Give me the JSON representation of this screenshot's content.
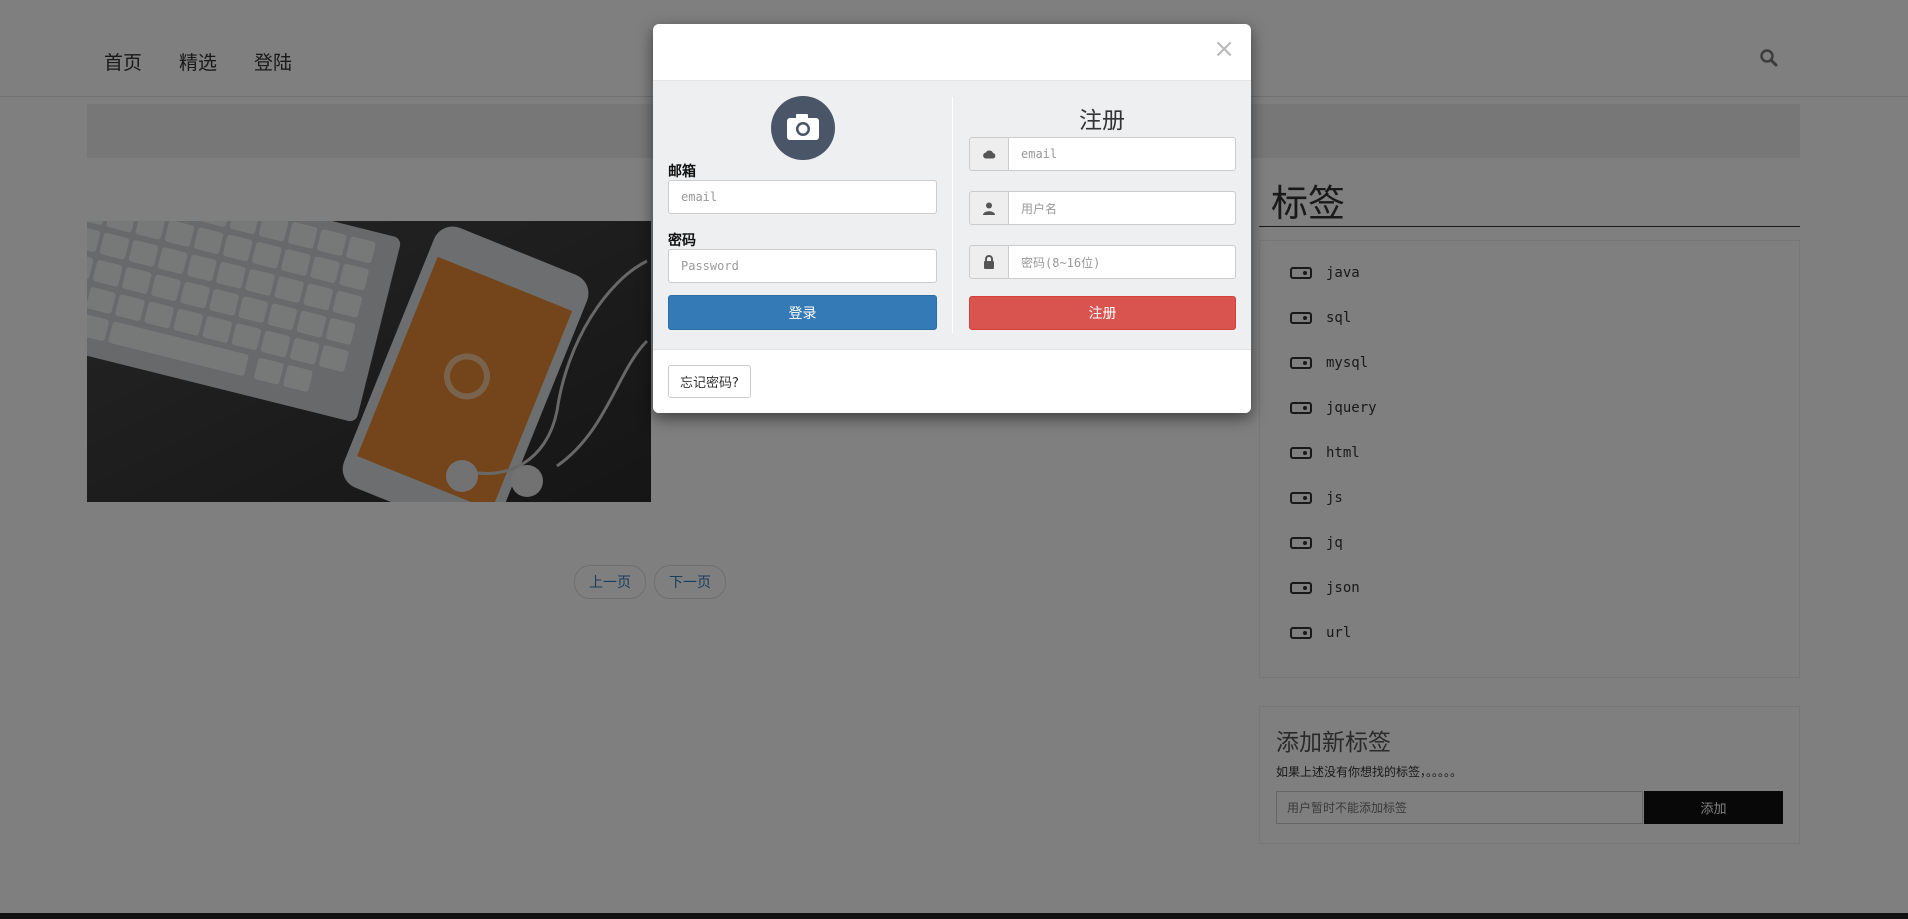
{
  "nav": {
    "items": [
      "首页",
      "精选",
      "登陆"
    ],
    "search_icon": "search-icon"
  },
  "pager": {
    "prev": "上一页",
    "next": "下一页"
  },
  "tags": {
    "title": "标签",
    "items": [
      "java",
      "sql",
      "mysql",
      "jquery",
      "html",
      "js",
      "jq",
      "json",
      "url"
    ],
    "icon": "tag-icon"
  },
  "add_tag": {
    "title": "添加新标签",
    "description": "如果上述没有你想找的标签，。。。。。",
    "placeholder": "用户暂时不能添加标签",
    "button": "添加"
  },
  "modal": {
    "close": "×",
    "login": {
      "avatar_icon": "camera-icon",
      "email_label": "邮箱",
      "email_placeholder": "email",
      "password_label": "密码",
      "password_placeholder": "Password",
      "submit": "登录"
    },
    "register": {
      "title": "注册",
      "email_placeholder": "email",
      "username_placeholder": "用户名",
      "password_placeholder": "密码(8~16位)",
      "submit": "注册"
    },
    "forgot": "忘记密码?"
  },
  "colors": {
    "primary": "#337ab7",
    "danger": "#d9534f",
    "avatar": "#4a5568",
    "add_button": "#111111"
  }
}
